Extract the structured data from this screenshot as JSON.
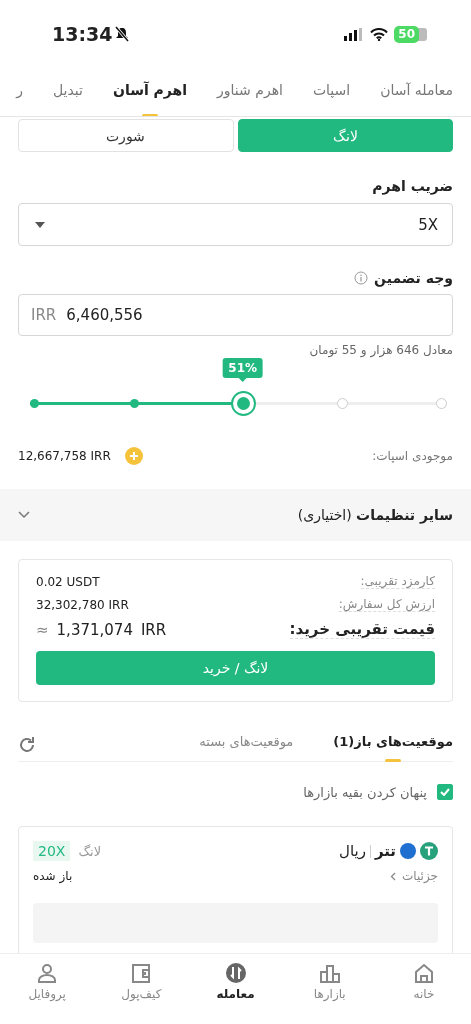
{
  "status_bar": {
    "time": "13:34",
    "muted": true,
    "battery": "50"
  },
  "tabs": [
    {
      "label": "معامله آسان",
      "selected": false
    },
    {
      "label": "اسپات",
      "selected": false
    },
    {
      "label": "اهرم شناور",
      "selected": false
    },
    {
      "label": "اهرم آسان",
      "selected": true
    },
    {
      "label": "تبدیل",
      "selected": false
    },
    {
      "label": "ر",
      "selected": false
    }
  ],
  "side_toggle": [
    {
      "label": "لانگ",
      "selected": true
    },
    {
      "label": "شورت",
      "selected": false
    }
  ],
  "leverage": {
    "label": "ضریب اهرم",
    "value": "5X"
  },
  "margin": {
    "label": "وجه تضمین",
    "unit": "IRR",
    "value": "6,460,556",
    "hint": "معادل 646 هزار و 55 تومان"
  },
  "slider": {
    "level": 0.51,
    "reading": "51%"
  },
  "balance": {
    "label": "موجودی اسپات:",
    "value": "12,667,758 IRR"
  },
  "more_settings": {
    "title": "**سایر تنظیمات** (اختیاری)",
    "expanded": false
  },
  "summary": {
    "rows": [
      {
        "kind": "small",
        "label": "کارمزد تقریبی:",
        "value": "0.02 USDT"
      },
      {
        "kind": "small",
        "label": "ارزش کل سفارش:",
        "value": "32,302,780 IRR"
      },
      {
        "kind": "large",
        "label": "قیمت تقریبی خرید:",
        "approx": "≈",
        "value": "1,371,074",
        "unit": "IRR"
      }
    ],
    "button": "لانگ / خرید"
  },
  "positions": {
    "tabs": [
      {
        "label": "موقعیت‌های باز(1)",
        "selected": true
      },
      {
        "label": "موقعیت‌های بسته",
        "selected": false
      }
    ],
    "hide_others": {
      "label": "پنهان کردن بقیه بازارها",
      "checked": true
    },
    "items": [
      {
        "base": "تتر",
        "quote": "ریال",
        "side": "لانگ",
        "leverage": "20X",
        "details": "جزئیات",
        "status": "باز شده"
      }
    ]
  },
  "bottom_nav": [
    {
      "kind": "home",
      "label": "خانه",
      "selected": false
    },
    {
      "kind": "markets",
      "label": "بازارها",
      "selected": false
    },
    {
      "kind": "trade",
      "label": "معامله",
      "selected": true
    },
    {
      "kind": "wallet",
      "label": "کیف‌پول",
      "selected": false
    },
    {
      "kind": "profile",
      "label": "پروفایل",
      "selected": false
    }
  ]
}
